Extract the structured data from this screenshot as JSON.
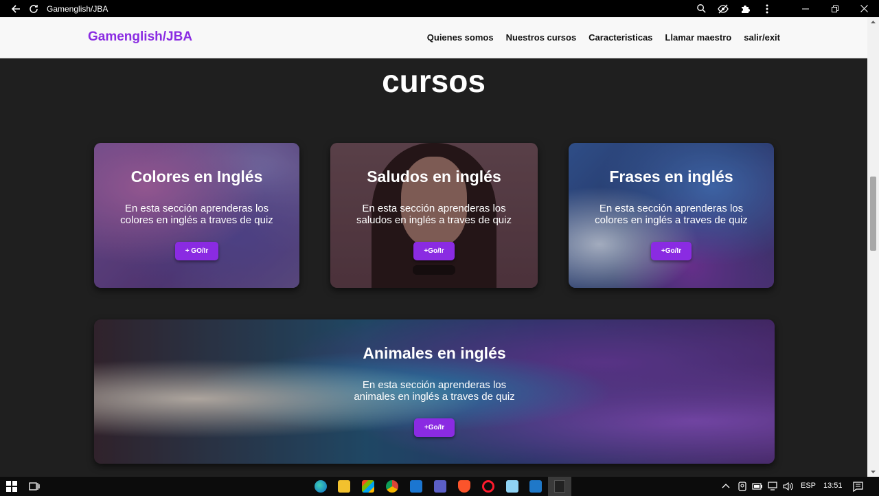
{
  "titlebar": {
    "title": "Gamenglish/JBA"
  },
  "site": {
    "brand": "Gamenglish/JBA",
    "nav": [
      "Quienes somos",
      "Nuestros cursos",
      "Caracteristicas",
      "Llamar maestro",
      "salir/exit"
    ]
  },
  "section": {
    "title": "cursos"
  },
  "cards": [
    {
      "title": "Colores en Inglés",
      "desc": "En esta sección aprenderas los colores en inglés a traves de quiz",
      "button": "+ GO/Ir"
    },
    {
      "title": "Saludos en inglés",
      "desc": "En esta sección aprenderas los saludos en inglés a traves de quiz",
      "button": "+Go/Ir"
    },
    {
      "title": "Frases en inglés",
      "desc": "En esta sección aprenderas los colores en inglés a traves de quiz",
      "button": "+Go/Ir"
    },
    {
      "title": "Animales en inglés",
      "desc": "En esta sección aprenderas los animales en inglés a traves de quiz",
      "button": "+Go/Ir"
    }
  ],
  "taskbar": {
    "lang": "ESP",
    "time": "13:51"
  },
  "colors": {
    "brand": "#8a2be2",
    "page_bg": "#1f1f1f",
    "navbar_bg": "#f8f8f8"
  }
}
